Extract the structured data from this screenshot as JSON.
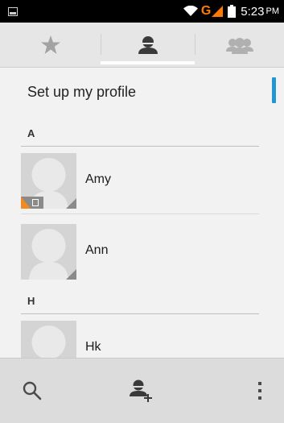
{
  "status_bar": {
    "network_label": "G",
    "time": "5:23",
    "ampm": "PM"
  },
  "tabs": [
    {
      "name": "favorites",
      "icon": "star-icon"
    },
    {
      "name": "contacts",
      "icon": "person-icon",
      "selected": true
    },
    {
      "name": "groups",
      "icon": "group-icon"
    }
  ],
  "list": {
    "profile_label": "Set up my profile",
    "sections": [
      {
        "letter": "A",
        "contacts": [
          {
            "name": "Amy",
            "sim_badge": true
          },
          {
            "name": "Ann"
          }
        ]
      },
      {
        "letter": "H",
        "contacts": [
          {
            "name": "Hk"
          }
        ]
      }
    ]
  },
  "bottom_bar": {
    "buttons": [
      {
        "icon": "search-icon"
      },
      {
        "icon": "add-contact-icon"
      },
      {
        "icon": "overflow-menu-icon"
      }
    ]
  },
  "colors": {
    "accent": "#2196d3",
    "network": "#ff7a00",
    "sim_badge": "#f28a1f"
  }
}
